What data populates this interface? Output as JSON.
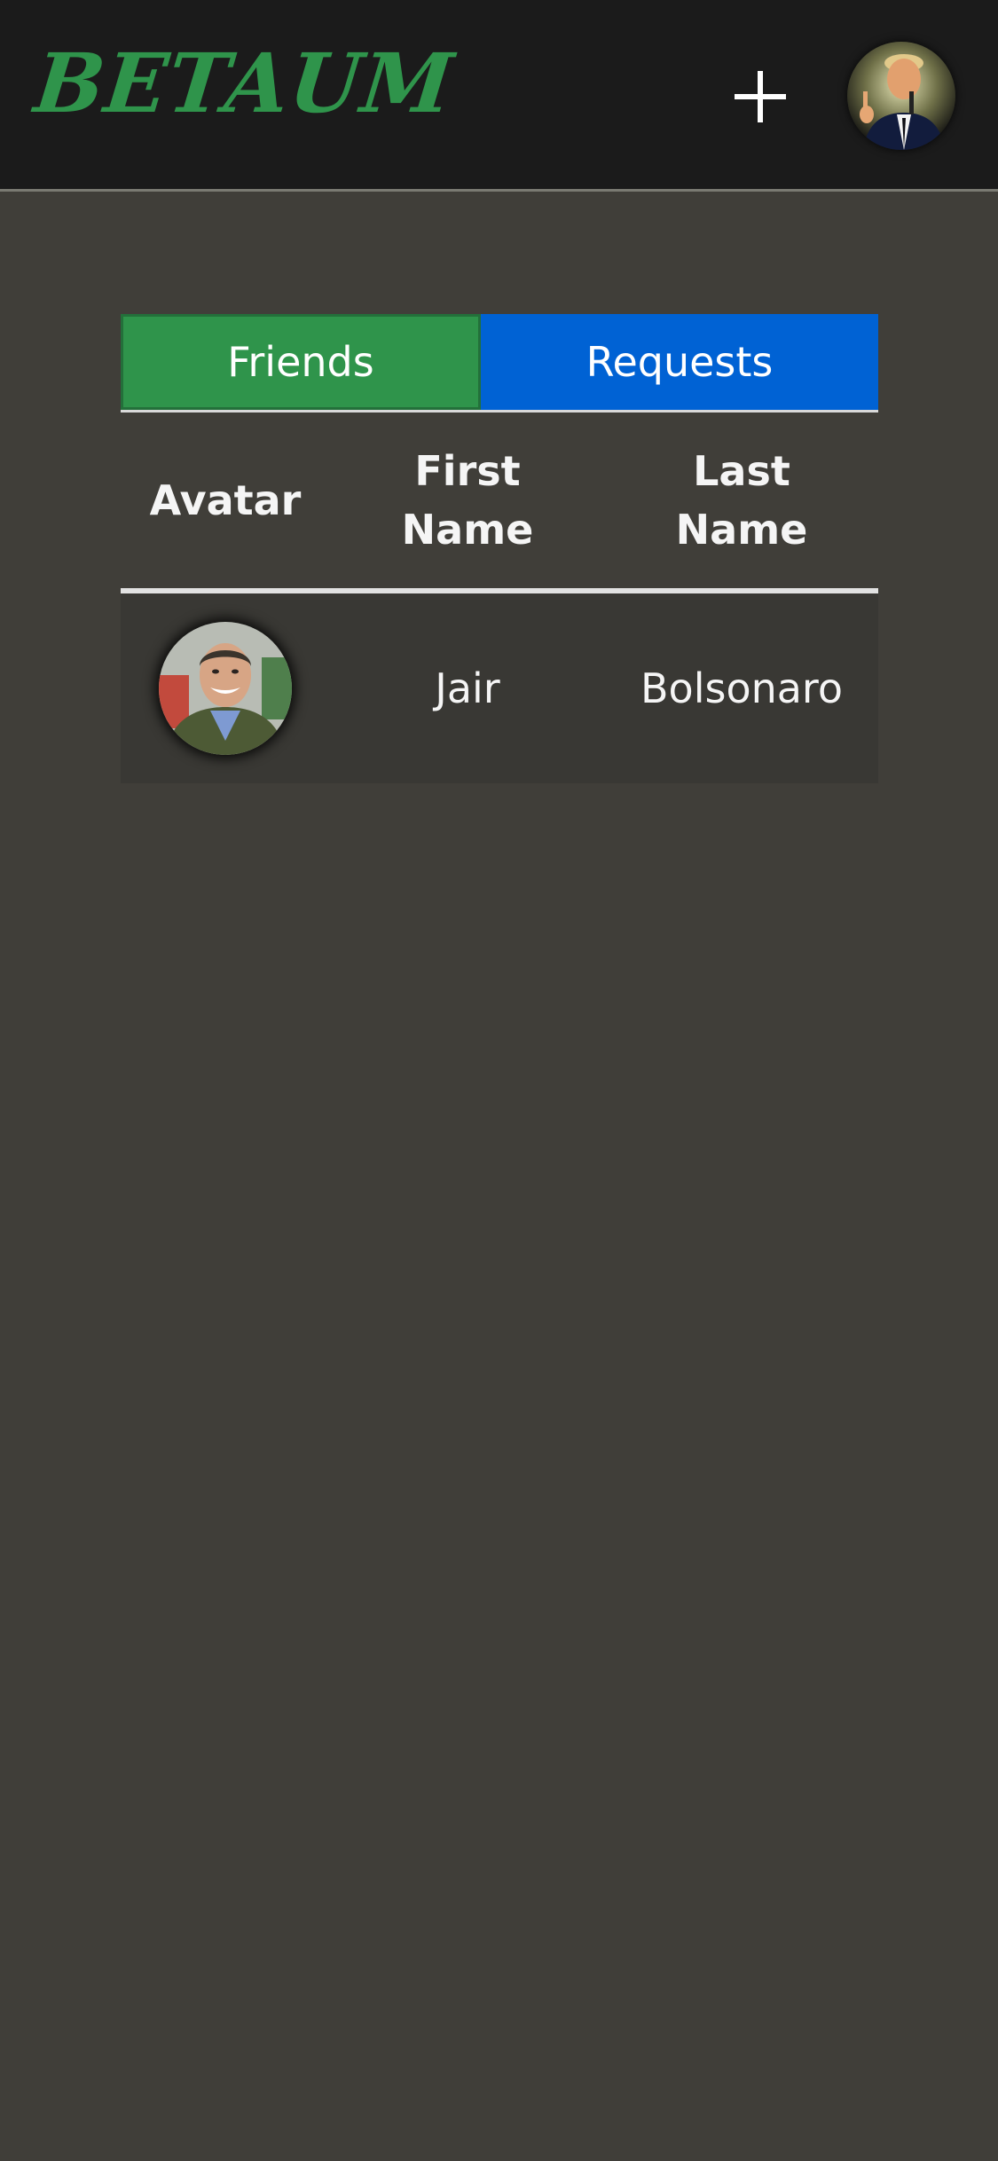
{
  "header": {
    "logo_text": "BETAUM",
    "add_icon": "plus-icon",
    "profile_avatar_icon": "user-avatar"
  },
  "tabs": [
    {
      "label": "Friends",
      "active": true,
      "color": "#2f944b"
    },
    {
      "label": "Requests",
      "active": false,
      "color": "#0062d4"
    }
  ],
  "table": {
    "columns": [
      "Avatar",
      "First\nName",
      "Last\nName"
    ],
    "column_labels": {
      "avatar": "Avatar",
      "first_line1": "First",
      "first_line2": "Name",
      "last_line1": "Last",
      "last_line2": "Name"
    },
    "rows": [
      {
        "avatar_icon": "friend-avatar",
        "first_name": "Jair",
        "last_name": "Bolsonaro"
      }
    ]
  },
  "colors": {
    "topbar": "#1b1b1b",
    "background": "#403e39",
    "brand_green": "#2f944b",
    "requests_blue": "#0062d4"
  }
}
